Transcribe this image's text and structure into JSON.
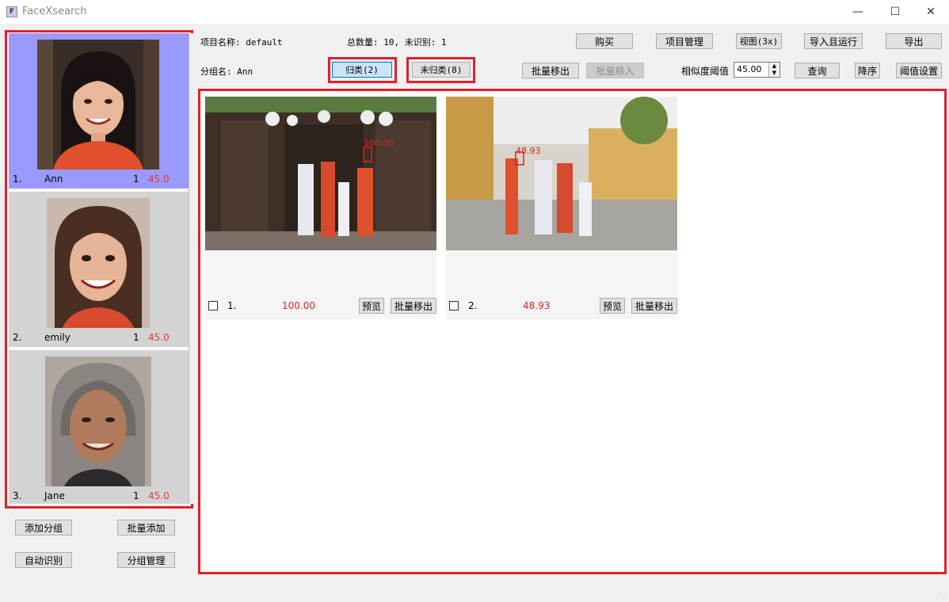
{
  "window": {
    "title": "FaceXsearch",
    "icon_letter": "F"
  },
  "header": {
    "project_label": "项目名称: default",
    "stats_label": "总数量: 10, 未识别: 1",
    "group_label": "分组名: Ann"
  },
  "toolbar": {
    "buy": "购买",
    "project_manage": "项目管理",
    "view": "视图(3x)",
    "import_run": "导入且运行",
    "export": "导出",
    "classified": "归类(2)",
    "unclassified": "未归类(8)",
    "batch_move_out": "批量移出",
    "batch_move_in": "批量移入",
    "similarity_label": "相似度阈值",
    "similarity_value": "45.00",
    "query": "查询",
    "sort_desc": "降序",
    "threshold_settings": "阈值设置"
  },
  "groups": [
    {
      "index": "1.",
      "name": "Ann",
      "count": "1",
      "threshold": "45.0",
      "selected": true
    },
    {
      "index": "2.",
      "name": "emily",
      "count": "1",
      "threshold": "45.0"
    },
    {
      "index": "3.",
      "name": "Jane",
      "count": "1",
      "threshold": "45.0"
    }
  ],
  "left_buttons": {
    "add_group": "添加分组",
    "batch_add": "批量添加",
    "auto_recognize": "自动识别",
    "group_manage": "分组管理"
  },
  "results": [
    {
      "index": "1.",
      "score": "100.00",
      "face_score": "100.00",
      "preview": "预览",
      "move_out": "批量移出"
    },
    {
      "index": "2.",
      "score": "48.93",
      "face_score": "48.93",
      "preview": "预览",
      "move_out": "批量移出"
    }
  ],
  "colors": {
    "highlight": "#e0202c",
    "selected_card": "#9999ff",
    "threshold_text": "#e03a3a"
  }
}
